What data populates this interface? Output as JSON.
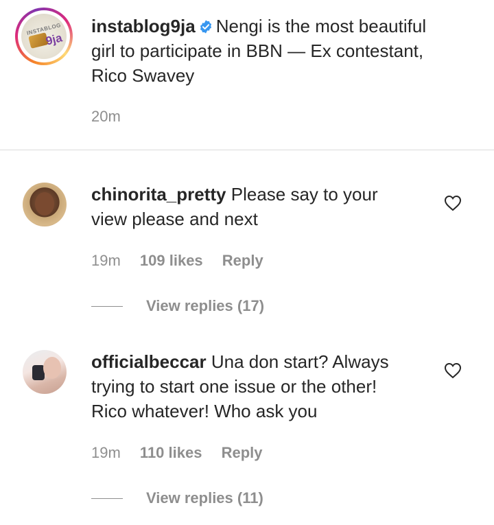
{
  "post": {
    "username": "instablog9ja",
    "caption_line1": "Nengi is the most beautiful",
    "caption_line2": "girl to participate in BBN — Ex contestant,",
    "caption_line3": "Rico Swavey",
    "time": "20m",
    "avatar_logo_text": "INSTABLOG",
    "avatar_logo_9ja": "9ja",
    "verified_color": "#3897f0"
  },
  "comments": [
    {
      "username": "chinorita_pretty",
      "line1": "Please say to your",
      "line2": "view please and next",
      "time": "19m",
      "likes": "109 likes",
      "reply_label": "Reply",
      "view_replies": "View replies (17)"
    },
    {
      "username": "officialbeccar",
      "line1": "Una don start? Always",
      "line2": "trying to start one issue or the other!",
      "line3": "Rico whatever! Who ask you",
      "time": "19m",
      "likes": "110 likes",
      "reply_label": "Reply",
      "view_replies": "View replies (11)"
    }
  ],
  "icons": {
    "like": "heart-outline-icon",
    "verified": "verified-badge-icon"
  }
}
